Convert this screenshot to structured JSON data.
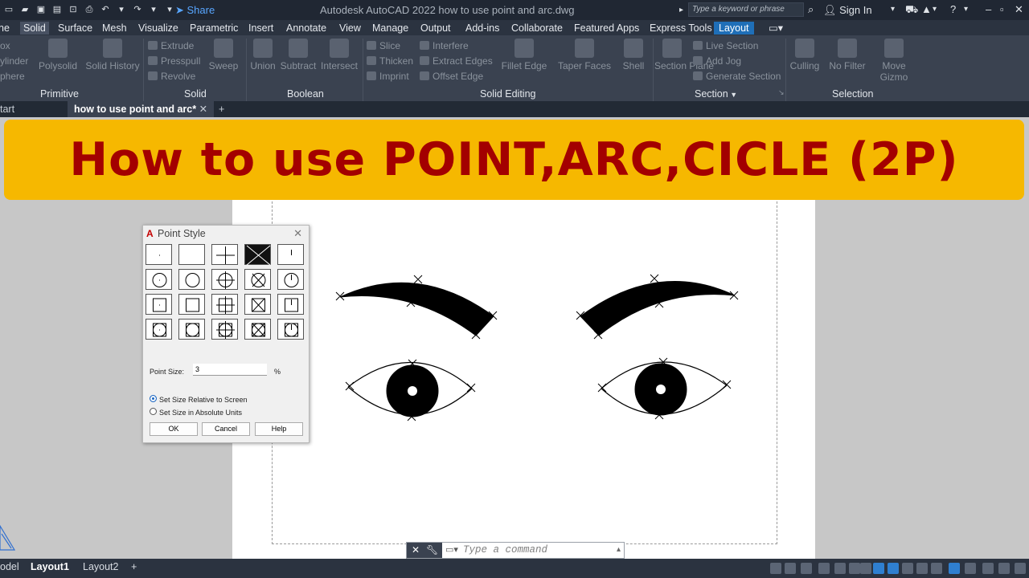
{
  "titlebar": {
    "share_label": "Share",
    "app_title": "Autodesk AutoCAD 2022    how to use point and arc.dwg",
    "search_placeholder": "Type a keyword or phrase",
    "signin_label": "Sign In"
  },
  "menu_tabs": [
    "ne",
    "Solid",
    "Surface",
    "Mesh",
    "Visualize",
    "Parametric",
    "Insert",
    "Annotate",
    "View",
    "Manage",
    "Output",
    "Add-ins",
    "Collaborate",
    "Featured Apps",
    "Express Tools",
    "Layout"
  ],
  "active_tab": "Solid",
  "ribbon": {
    "primitive_items": [
      "ox",
      "ylinder",
      "phere"
    ],
    "polysolid": "Polysolid",
    "solid_history": "Solid History",
    "extrude": "Extrude",
    "presspull": "Presspull",
    "revolve": "Revolve",
    "sweep": "Sweep",
    "union": "Union",
    "subtract": "Subtract",
    "intersect": "Intersect",
    "slice": "Slice",
    "thicken": "Thicken",
    "imprint": "Imprint",
    "interfere": "Interfere",
    "extract_edges": "Extract Edges",
    "offset_edge": "Offset Edge",
    "fillet_edge": "Fillet Edge",
    "taper_faces": "Taper Faces",
    "shell": "Shell",
    "section_plane": "Section Plane",
    "live_section": "Live Section",
    "add_jog": "Add Jog",
    "generate_section": "Generate Section",
    "culling": "Culling",
    "no_filter": "No Filter",
    "move_gizmo": "Move Gizmo",
    "panels": {
      "primitive": "Primitive",
      "solid": "Solid",
      "boolean": "Boolean",
      "solid_editing": "Solid Editing",
      "section": "Section",
      "selection": "Selection"
    }
  },
  "doc_tabs": {
    "start": "tart",
    "current": "how to use point and arc*"
  },
  "banner": "How to use POINT,ARC,CICLE (2P)",
  "command": {
    "placeholder": "Type a command"
  },
  "dialog": {
    "title": "Point Style",
    "point_size_label": "Point Size:",
    "point_size_value": "3",
    "percent": "%",
    "option_relative": "Set Size Relative to Screen",
    "option_absolute": "Set Size in Absolute Units",
    "selected_option": "relative",
    "ok": "OK",
    "cancel": "Cancel",
    "help": "Help"
  },
  "status": {
    "model_tab": "odel",
    "layout1": "Layout1",
    "layout2": "Layout2"
  },
  "colors": {
    "banner_bg": "#f6b800",
    "banner_text": "#a30000",
    "accent": "#1f6fb8"
  }
}
